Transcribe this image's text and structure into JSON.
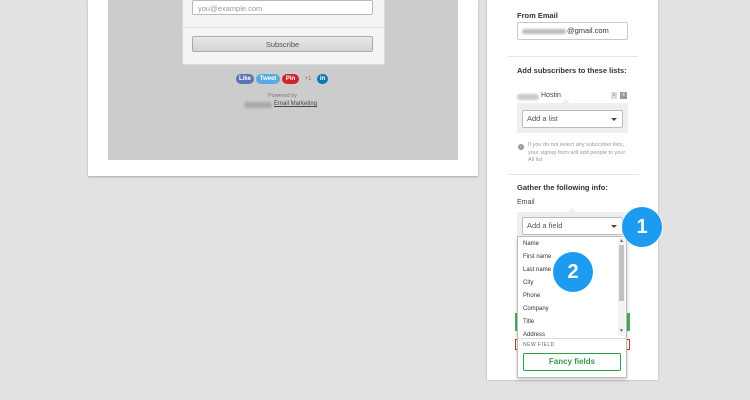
{
  "preview": {
    "email_placeholder": "you@example.com",
    "subscribe_label": "Subscribe",
    "social": {
      "like": "Like",
      "tweet": "Tweet",
      "pin": "Pin",
      "plus_one": "+1",
      "linkedin": "in"
    },
    "powered_by": "Powered by",
    "email_marketing": "Email Marketing"
  },
  "panel": {
    "from_email_heading": "From Email",
    "from_email_value": "@gmail.com",
    "lists_heading": "Add subscribers to these lists:",
    "list_item_name": "Hostin",
    "list_remove_a": "x",
    "list_remove_b": "x",
    "add_list_placeholder": "Add a list",
    "info_icon": "i",
    "info_text": "If you do not select any subscriber lists, your signup form will add people to your All list",
    "gather_heading": "Gather the following info:",
    "email_label": "Email",
    "add_field_placeholder": "Add a field",
    "field_options": [
      "Name",
      "First name",
      "Last name",
      "City",
      "Phone",
      "Company",
      "Title",
      "Address"
    ],
    "scroll_up": "▲",
    "scroll_down": "▼",
    "new_field_label": "NEW FIELD",
    "fancy_fields_label": "Fancy fields"
  },
  "badges": {
    "one": "1",
    "two": "2"
  },
  "colors": {
    "accent_blue": "#1d9bf0",
    "green": "#2e9d4c",
    "red": "#c43a3a"
  }
}
